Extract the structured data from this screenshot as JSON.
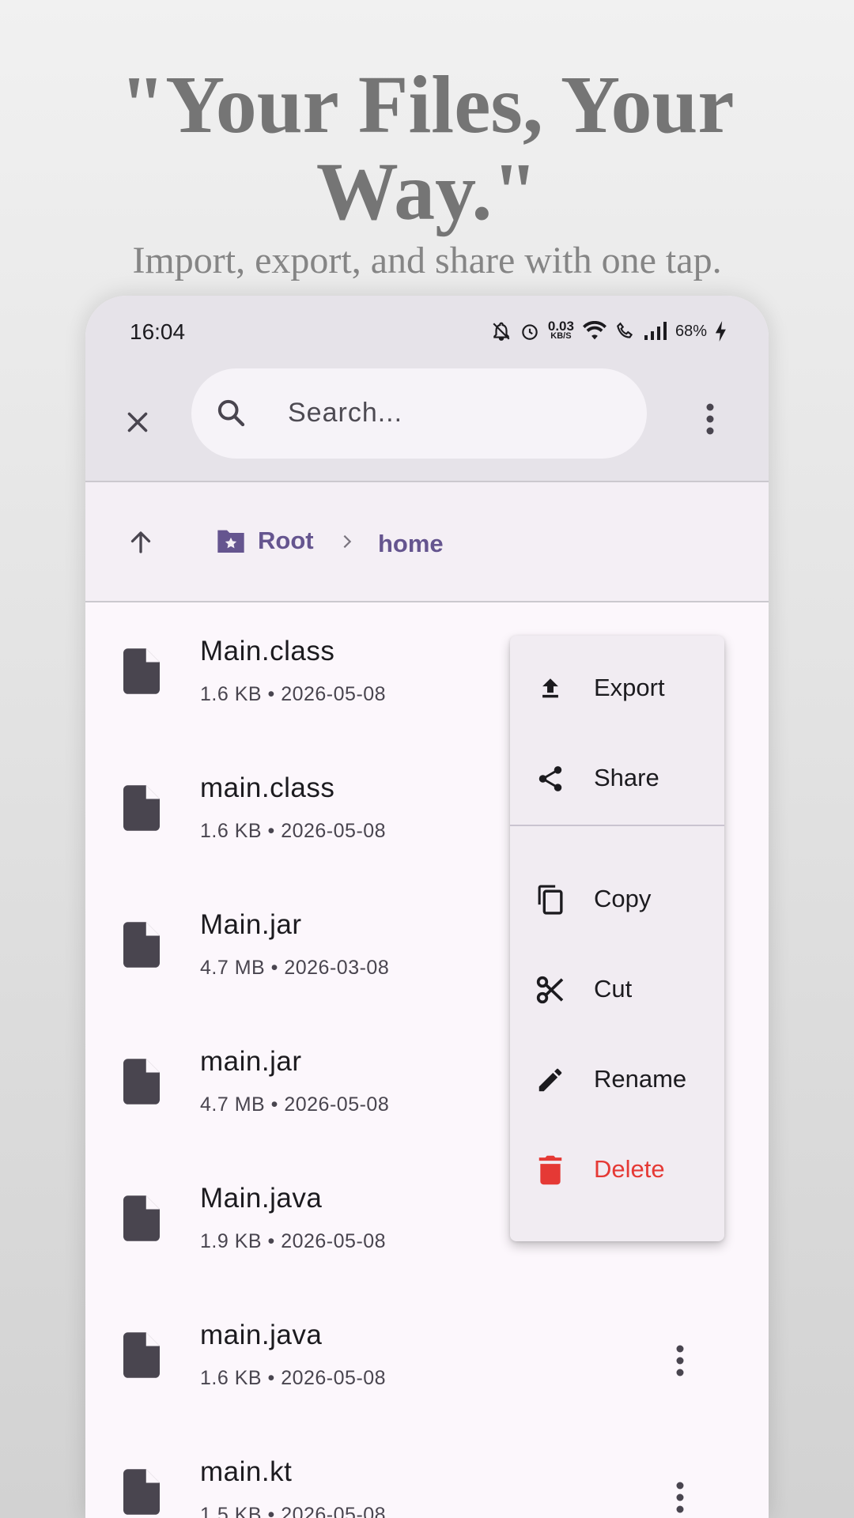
{
  "promo": {
    "headline": "\"Your Files, Your Way.\"",
    "subline": "Import, export, and share with one tap."
  },
  "status_bar": {
    "time": "16:04",
    "net_speed_value": "0.03",
    "net_speed_unit": "KB/S",
    "battery": "68%"
  },
  "app_bar": {
    "search_placeholder": "Search..."
  },
  "breadcrumb": {
    "root": "Root",
    "current": "home"
  },
  "files": [
    {
      "name": "Main.class",
      "meta": "1.6 KB • 2026-05-08"
    },
    {
      "name": "main.class",
      "meta": "1.6 KB • 2026-05-08"
    },
    {
      "name": "Main.jar",
      "meta": "4.7 MB • 2026-03-08"
    },
    {
      "name": "main.jar",
      "meta": "4.7 MB • 2026-05-08"
    },
    {
      "name": "Main.java",
      "meta": "1.9 KB • 2026-05-08"
    },
    {
      "name": "main.java",
      "meta": "1.6 KB • 2026-05-08"
    },
    {
      "name": "main.kt",
      "meta": "1.5 KB • 2026-05-08"
    }
  ],
  "context_menu": {
    "items": [
      {
        "label": "Export",
        "icon": "upload-icon"
      },
      {
        "label": "Share",
        "icon": "share-icon"
      },
      {
        "label": "Copy",
        "icon": "copy-icon"
      },
      {
        "label": "Cut",
        "icon": "scissors-icon"
      },
      {
        "label": "Rename",
        "icon": "pencil-icon"
      },
      {
        "label": "Delete",
        "icon": "trash-icon"
      }
    ]
  },
  "colors": {
    "accent": "#65558f",
    "danger": "#e53935",
    "app_bar_bg": "#e6e3e9",
    "list_bg": "#fcf7fc",
    "menu_bg": "#f1ecf2"
  }
}
